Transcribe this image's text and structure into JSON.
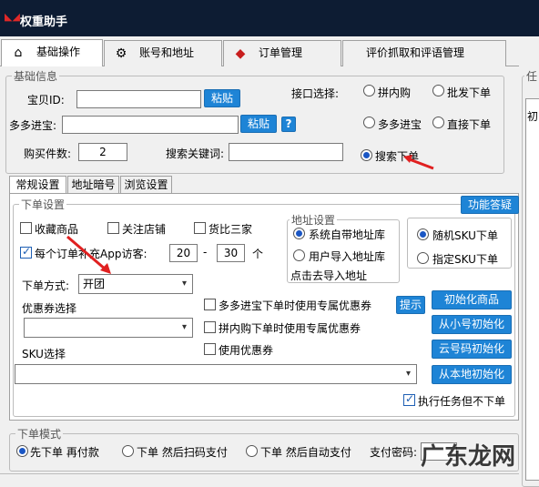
{
  "app": {
    "title": "权重助手"
  },
  "main_tabs": [
    {
      "label": "基础操作",
      "icon": "home-icon"
    },
    {
      "label": "账号和地址",
      "icon": "gear-icon"
    },
    {
      "label": "订单管理",
      "icon": "diamond-icon"
    },
    {
      "label": "评价抓取和评语管理"
    }
  ],
  "basic_info": {
    "legend": "基础信息",
    "product_id_label": "宝贝ID:",
    "product_id_value": "",
    "paste_label": "粘贴",
    "pdd_entry_label": "多多进宝:",
    "pdd_entry_value": "",
    "paste2_label": "粘贴",
    "help_label": "?",
    "qty_label": "购买件数:",
    "qty_value": "2",
    "keyword_label": "搜索关键词:",
    "keyword_value": "",
    "api_label": "接口选择:",
    "api_options": [
      "拼内购",
      "批发下单",
      "多多进宝",
      "直接下单",
      "搜索下单"
    ],
    "api_selected": "搜索下单"
  },
  "sub_tabs": [
    "常规设置",
    "地址暗号",
    "浏览设置"
  ],
  "order_settings": {
    "legend": "下单设置",
    "faq_label": "功能答疑",
    "fav_product": "收藏商品",
    "follow_shop": "关注店铺",
    "compare": "货比三家",
    "app_visitor_label": "每个订单补充App访客:",
    "app_visitor_min": "20",
    "app_visitor_dash": "-",
    "app_visitor_max": "30",
    "app_visitor_unit": "个",
    "order_mode_label": "下单方式:",
    "order_mode_value": "开团",
    "coupon_label": "优惠券选择",
    "coupon_value": "",
    "sku_label": "SKU选择",
    "sku_value": "",
    "pdd_coupon": "多多进宝下单时使用专属优惠券",
    "pnj_coupon": "拼内购下单时使用专属优惠券",
    "use_coupon": "使用优惠券",
    "hint_label": "提示",
    "address": {
      "legend": "地址设置",
      "system": "系统自带地址库",
      "user": "用户导入地址库",
      "import_link": "点击去导入地址"
    },
    "sku_random": "随机SKU下单",
    "sku_fixed": "指定SKU下单",
    "btn_init_product": "初始化商品",
    "btn_small_init": "从小号初始化",
    "btn_cloud_init": "云号码初始化",
    "btn_local_init": "从本地初始化",
    "exec_no_order": "执行任务但不下单"
  },
  "order_mode": {
    "legend": "下单模式",
    "opt1": "先下单 再付款",
    "opt2": "下单 然后扫码支付",
    "opt3": "下单 然后自动支付",
    "pay_pwd_label": "支付密码:"
  },
  "right_panel": {
    "legend": "任",
    "text": "初"
  },
  "watermark": "广东龙网"
}
